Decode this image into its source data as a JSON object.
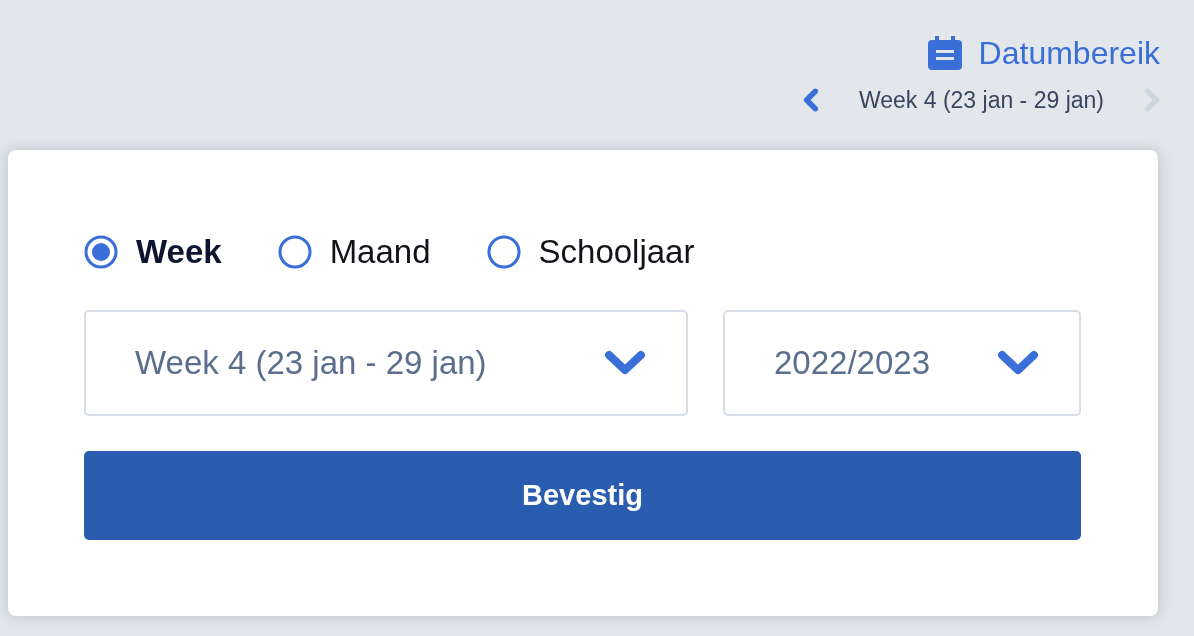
{
  "header": {
    "title": "Datumbereik",
    "period_nav": {
      "label": "Week 4 (23 jan - 29 jan)",
      "prev_disabled": false,
      "next_disabled": true
    }
  },
  "panel": {
    "period_types": [
      {
        "label": "Week",
        "selected": true
      },
      {
        "label": "Maand",
        "selected": false
      },
      {
        "label": "Schooljaar",
        "selected": false
      }
    ],
    "selects": [
      {
        "kind": "week",
        "value": "Week 4 (23 jan - 29 jan)"
      },
      {
        "kind": "year",
        "value": "2022/2023"
      }
    ],
    "confirm_button": "Bevestig"
  }
}
